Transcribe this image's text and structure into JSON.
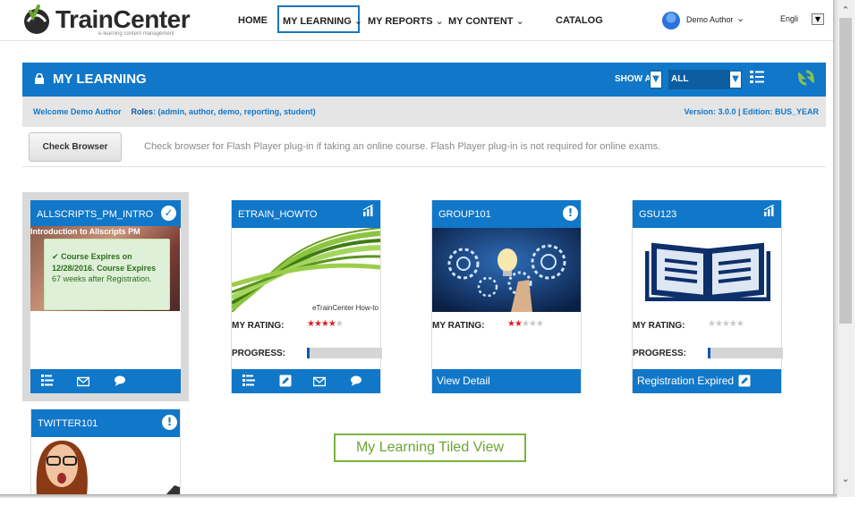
{
  "brand": {
    "name": "TrainCenter",
    "tagline": "e-learning content management"
  },
  "nav": {
    "home": "HOME",
    "my_learning": "MY LEARNING",
    "my_reports": "MY REPORTS",
    "my_content": "MY CONTENT",
    "catalog": "CATALOG",
    "user": "Demo Author",
    "language": "Engli"
  },
  "header": {
    "title": "MY LEARNING",
    "show_all": "SHOW ALL",
    "filter": "ALL"
  },
  "welcome": {
    "greeting": "Welcome  Demo Author",
    "roles_label": "Roles",
    "roles": ": (admin, author, demo, reporting, student)",
    "version": "Version: 3.0.0  |  Edition: BUS_YEAR"
  },
  "check": {
    "button": "Check Browser",
    "note": "Check browser for Flash Player plug-in if taking an online course. Flash Player plug-in is not required for online exams."
  },
  "tiles": [
    {
      "title": "ALLSCRIPTS_PM_INTRO",
      "image_caption": "Introduction to Allscripts PM",
      "expire_bold1": "Course Expires on 12/28/2016.",
      "expire_bold2": "Course Expires",
      "expire_rest": " 67 weeks after Registration."
    },
    {
      "title": "ETRAIN_HOWTO",
      "image_caption": "eTrainCenter How-to",
      "rating_label": "MY RATING:",
      "rating": 4,
      "progress_label": "PROGRESS:",
      "progress": 0.03
    },
    {
      "title": "GROUP101",
      "rating_label": "MY RATING:",
      "rating": 2,
      "footer": "View Detail"
    },
    {
      "title": "GSU123",
      "rating_label": "MY RATING:",
      "rating": 0,
      "progress_label": "PROGRESS:",
      "progress": 0.03,
      "footer": "Registration Expired"
    },
    {
      "title": "TWITTER101"
    }
  ],
  "callout": "My Learning Tiled View",
  "colors": {
    "primary": "#1177c8",
    "accent": "#6aa533",
    "star": "#e02020"
  }
}
